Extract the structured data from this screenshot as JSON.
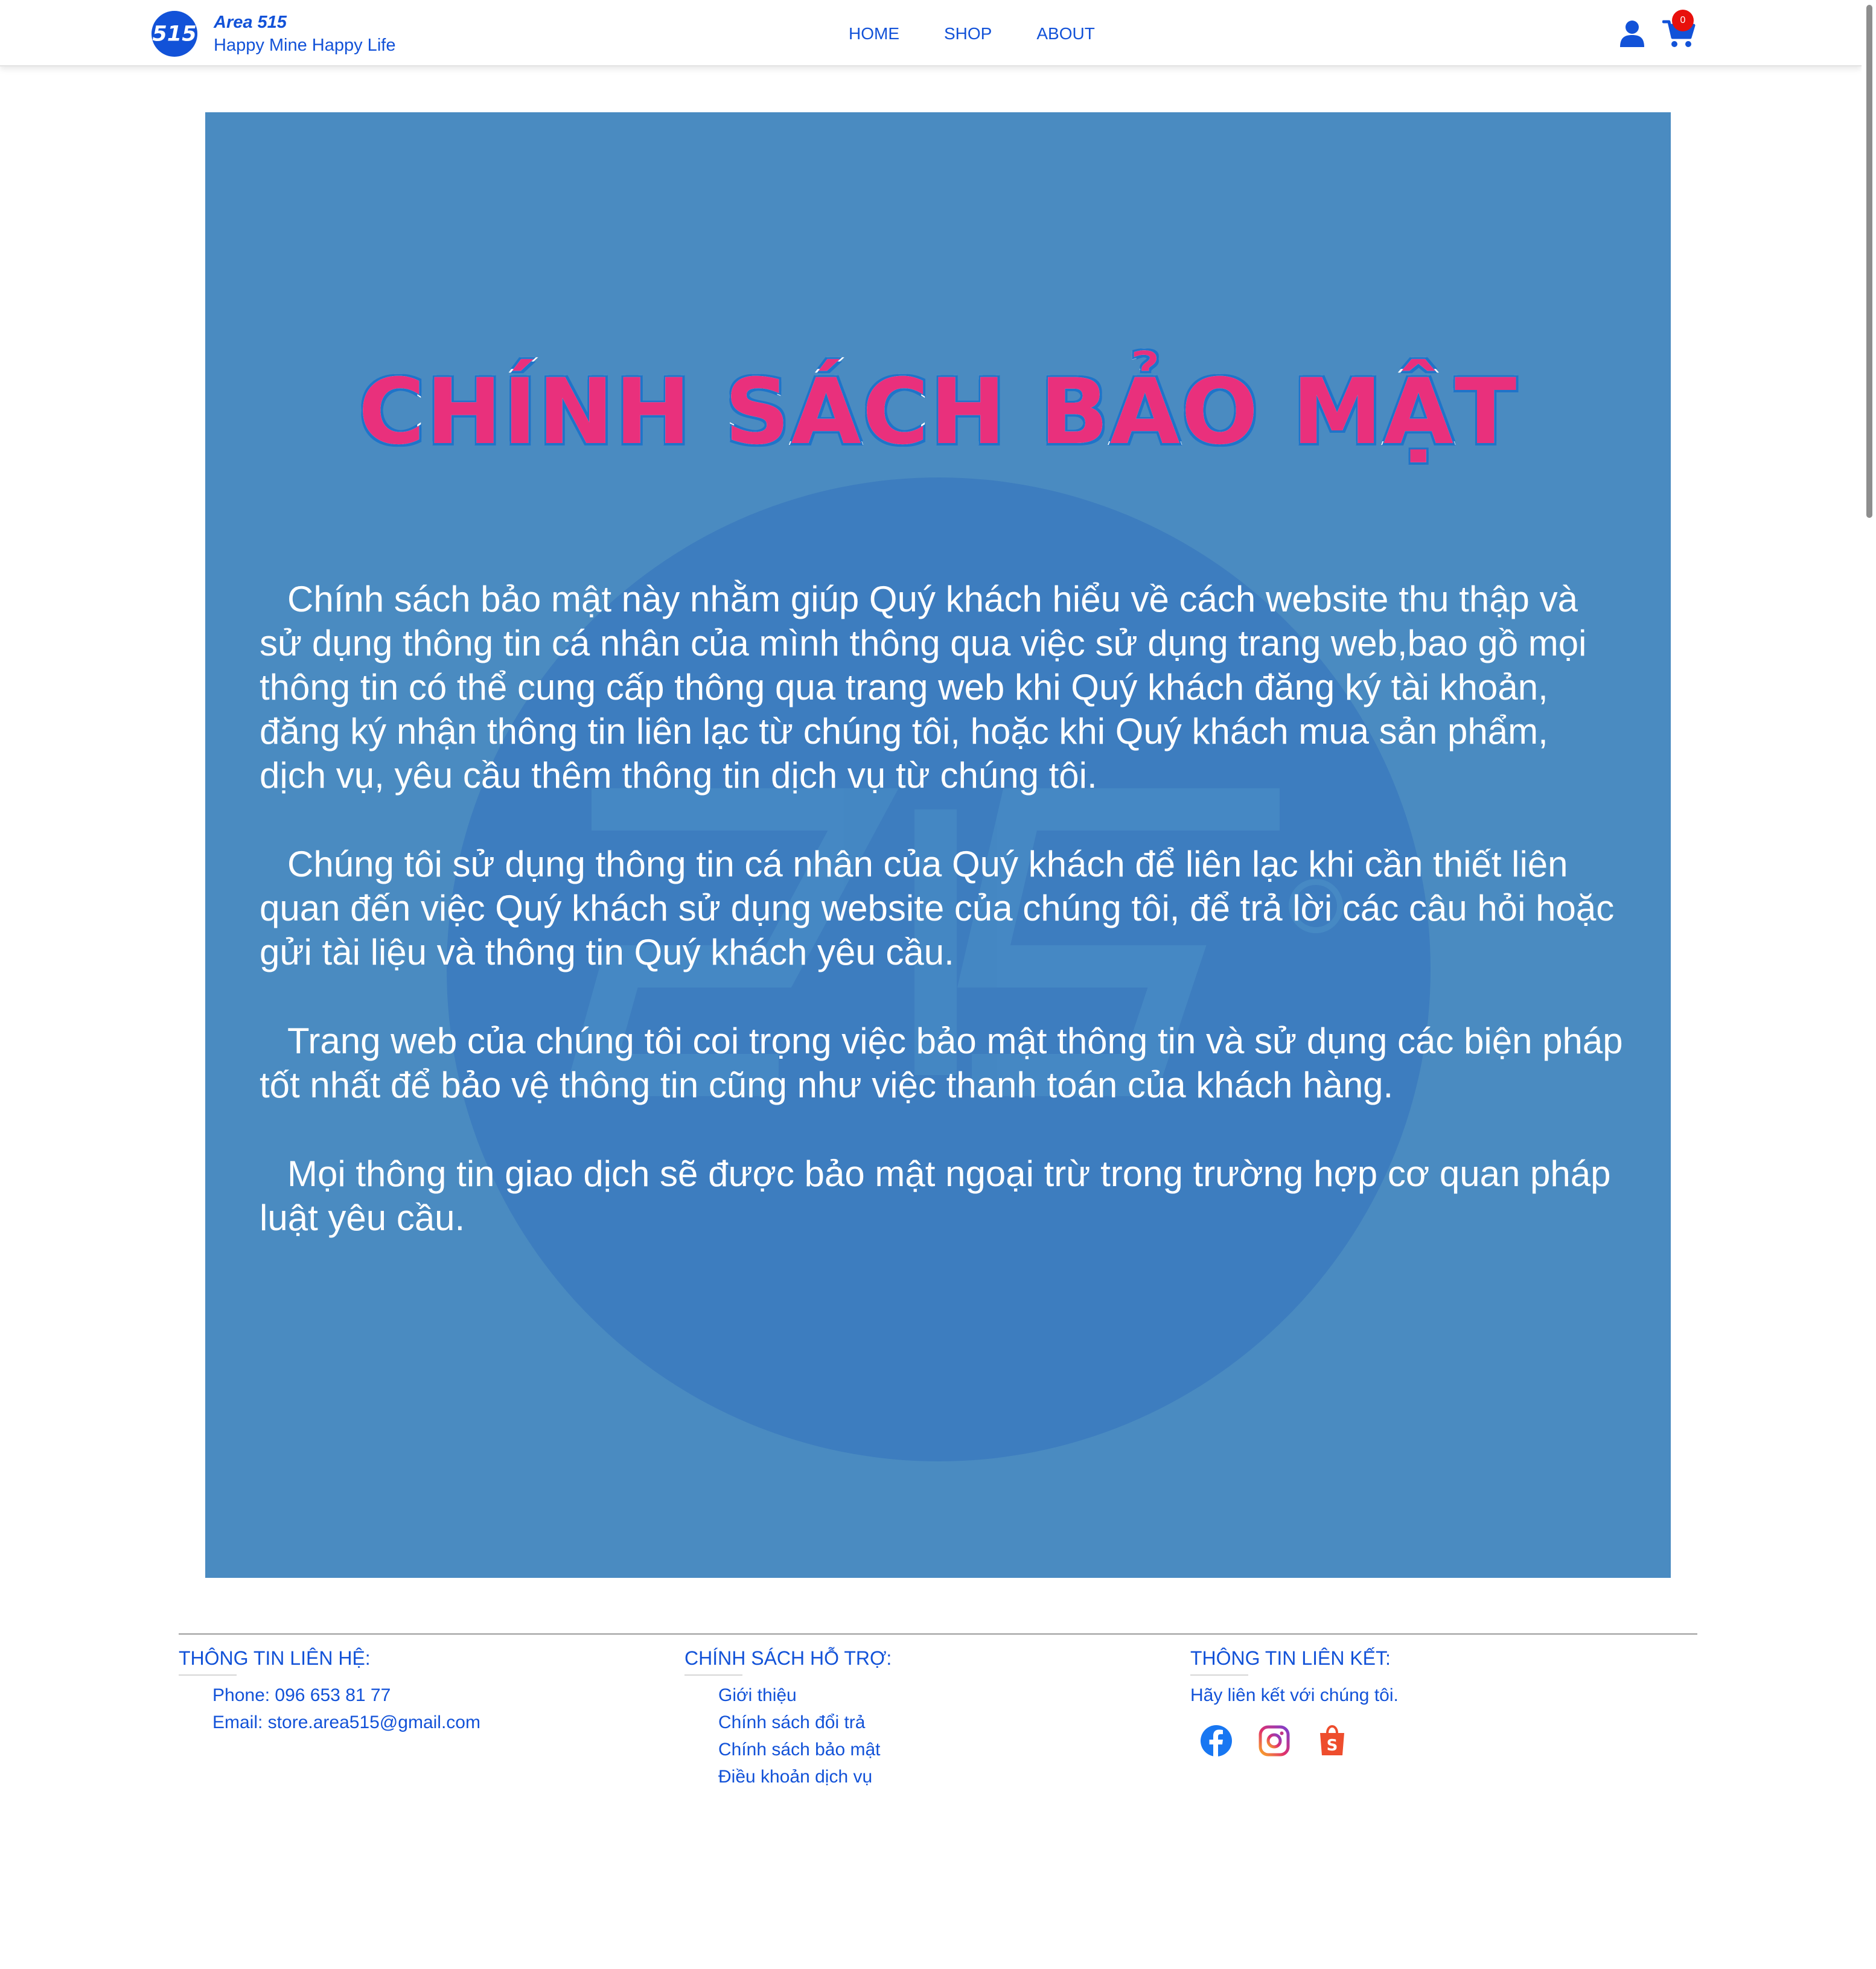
{
  "header": {
    "brand_name": "Area 515",
    "brand_slogan": "Happy Mine Happy Life",
    "logo_text": "515",
    "nav": {
      "home": "HOME",
      "shop": "SHOP",
      "about": "ABOUT"
    },
    "cart_count": "0",
    "icons": [
      "user-icon",
      "cart-icon"
    ]
  },
  "banner": {
    "title": "CHÍNH SÁCH BẢO MẬT",
    "paragraphs": [
      "Chính sách bảo mật này nhằm giúp Quý khách hiểu về cách website thu thập và sử dụng thông tin cá nhân của mình thông qua việc sử dụng trang web,bao gồ mọi thông tin có thể cung cấp thông qua trang web khi Quý khách đăng ký tài khoản, đăng ký nhận thông tin liên lạc từ chúng tôi, hoặc khi Quý khách mua sản phẩm, dịch vụ, yêu cầu thêm thông tin dịch vụ từ chúng tôi.",
      "Chúng tôi sử dụng thông tin cá nhân của Quý khách để liên lạc khi cần thiết liên quan đến việc Quý khách sử dụng website của chúng tôi, để trả lời các câu hỏi hoặc gửi tài liệu và thông tin Quý khách yêu cầu.",
      "Trang web của chúng tôi coi trọng việc bảo mật thông tin và sử dụng các biện pháp tốt nhất để bảo vệ thông tin cũng như việc thanh toán của khách hàng.",
      "Mọi thông tin giao dịch sẽ được bảo mật ngoại trừ trong trường hợp cơ quan pháp luật yêu cầu."
    ]
  },
  "footer": {
    "contact": {
      "heading": "THÔNG TIN LIÊN HỆ:",
      "phone": "Phone: 096 653 81 77",
      "email": "Email: store.area515@gmail.com"
    },
    "support": {
      "heading": "CHÍNH SÁCH HỖ TRỢ:",
      "links": [
        "Giới thiệu",
        "Chính sách đổi trả",
        "Chính sách bảo mật",
        "Điều khoản dịch vụ"
      ]
    },
    "social": {
      "heading": "THÔNG TIN LIÊN KẾT:",
      "text": "Hãy liên kết với chúng tôi.",
      "icons": [
        "facebook-icon",
        "instagram-icon",
        "shopee-icon"
      ]
    }
  },
  "colors": {
    "primary": "#1252d8",
    "banner_bg": "#4a8bc1",
    "title_pink": "#e9307c",
    "badge_red": "#e8100c",
    "facebook": "#1877f2",
    "shopee": "#ee4d2d"
  }
}
